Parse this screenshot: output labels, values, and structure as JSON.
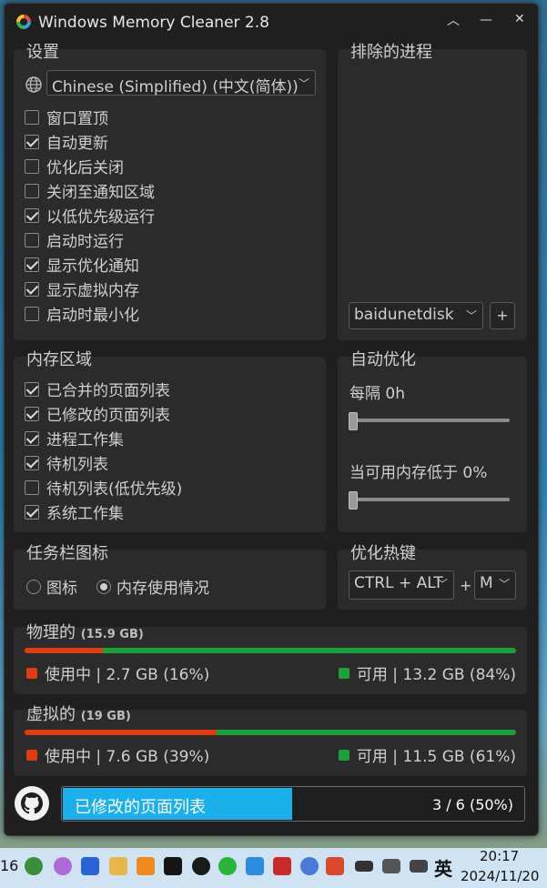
{
  "window": {
    "title": "Windows Memory Cleaner 2.8",
    "minimize_icon": "minimize-icon",
    "restore_icon": "chevron-up-icon",
    "close_icon": "close-icon"
  },
  "settings": {
    "title": "设置",
    "language": "Chinese (Simplified) (中文(简体))",
    "options": [
      {
        "label": "窗口置顶",
        "checked": false
      },
      {
        "label": "自动更新",
        "checked": true
      },
      {
        "label": "优化后关闭",
        "checked": false
      },
      {
        "label": "关闭至通知区域",
        "checked": false
      },
      {
        "label": "以低优先级运行",
        "checked": true
      },
      {
        "label": "启动时运行",
        "checked": false
      },
      {
        "label": "显示优化通知",
        "checked": true
      },
      {
        "label": "显示虚拟内存",
        "checked": true
      },
      {
        "label": "启动时最小化",
        "checked": false
      }
    ]
  },
  "excluded": {
    "title": "排除的进程",
    "process": "baidunetdisk",
    "add_label": "+"
  },
  "memory_areas": {
    "title": "内存区域",
    "options": [
      {
        "label": "已合并的页面列表",
        "checked": true
      },
      {
        "label": "已修改的页面列表",
        "checked": true
      },
      {
        "label": "进程工作集",
        "checked": true
      },
      {
        "label": "待机列表",
        "checked": true
      },
      {
        "label": "待机列表(低优先级)",
        "checked": false
      },
      {
        "label": "系统工作集",
        "checked": true
      }
    ]
  },
  "auto_optimize": {
    "title": "自动优化",
    "interval_label": "每隔 0h",
    "interval_value": 0,
    "threshold_label": "当可用内存低于 0%",
    "threshold_value": 0
  },
  "tray_icon": {
    "title": "任务栏图标",
    "option_icon": "图标",
    "option_usage": "内存使用情况",
    "selected": "内存使用情况"
  },
  "hotkey": {
    "title": "优化热键",
    "modifier": "CTRL + ALT",
    "plus": "+",
    "key": "M"
  },
  "physical": {
    "title": "物理的",
    "total": "(15.9 GB)",
    "used_label": "使用中 | 2.7 GB (16%)",
    "free_label": "可用 | 13.2 GB (84%)",
    "used_percent": 16
  },
  "virtual": {
    "title": "虚拟的",
    "total": "(19 GB)",
    "used_label": "使用中 | 7.6 GB (39%)",
    "free_label": "可用 | 11.5 GB (61%)",
    "used_percent": 39
  },
  "progress": {
    "label": "已修改的页面列表",
    "count": "3 / 6 (50%)",
    "percent": 50
  },
  "colors": {
    "used": "#e03a0e",
    "free": "#1aa23a",
    "progress": "#1ab0ec"
  },
  "taskbar": {
    "left_number": "16",
    "ime": "英",
    "time": "20:17",
    "date": "2024/11/20",
    "icons": [
      "browser-icon",
      "cat-app-icon",
      "code-icon",
      "folder-icon",
      "shield-icon",
      "media-icon",
      "qq-icon",
      "wechat-icon",
      "cloud-icon",
      "blocked-app-icon",
      "link-icon",
      "speaker-alert-icon",
      "battery-icon",
      "network-icon",
      "volume-icon"
    ]
  }
}
